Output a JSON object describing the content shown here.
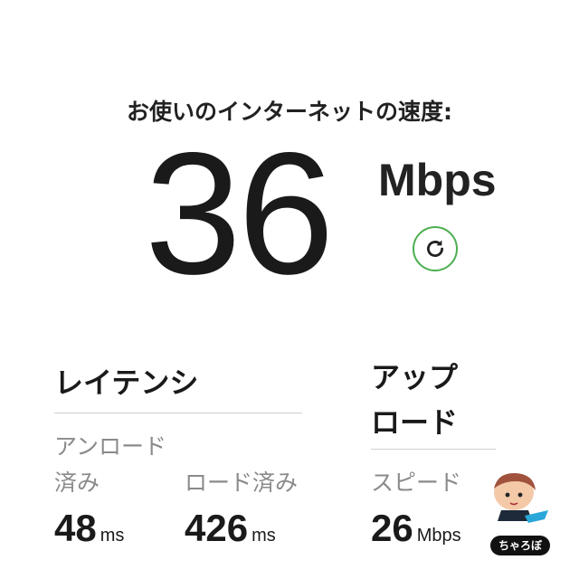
{
  "header": {
    "title": "お使いのインターネットの速度:"
  },
  "download": {
    "value": "36",
    "unit": "Mbps"
  },
  "refresh": {
    "icon": "refresh-icon",
    "ring_color": "#4caf50"
  },
  "latency": {
    "title": "レイテンシ",
    "unloaded": {
      "label_line1": "アンロード",
      "label_line2": "済み",
      "value": "48",
      "unit": "ms"
    },
    "loaded": {
      "label": "ロード済み",
      "value": "426",
      "unit": "ms"
    }
  },
  "upload": {
    "title_line1": "アップ",
    "title_line2": "ロード",
    "label": "スピード",
    "value": "26",
    "unit": "Mbps"
  },
  "mascot": {
    "badge_text": "ちゃろぼ"
  }
}
